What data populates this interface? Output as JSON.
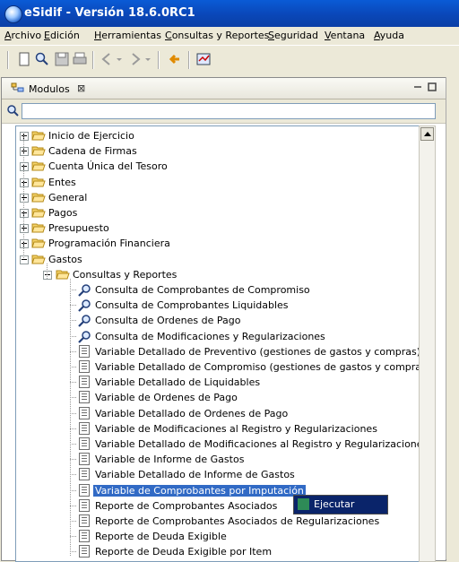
{
  "window": {
    "title": "eSidif - Versión 18.6.0RC1"
  },
  "menu": [
    "Archivo",
    "Edición",
    "Herramientas",
    "Consultas y Reportes",
    "Seguridad",
    "Ventana",
    "Ayuda"
  ],
  "panel": {
    "tab_label": "Modulos",
    "search_value": ""
  },
  "tree": {
    "top_level": [
      "Inicio de Ejercicio",
      "Cadena de Firmas",
      "Cuenta Única del Tesoro",
      "Entes",
      "General",
      "Pagos",
      "Presupuesto",
      "Programación Financiera",
      "Gastos"
    ],
    "subfolder": "Consultas y Reportes",
    "items": [
      {
        "label": "Consulta de Comprobantes de Compromiso",
        "icon": "magnifier-icon"
      },
      {
        "label": "Consulta de Comprobantes Liquidables",
        "icon": "magnifier-icon"
      },
      {
        "label": "Consulta de Ordenes de Pago",
        "icon": "magnifier-icon"
      },
      {
        "label": "Consulta de Modificaciones y Regularizaciones",
        "icon": "magnifier-icon"
      },
      {
        "label": "Variable Detallado de Preventivo (gestiones de gastos y compras)",
        "icon": "document-icon"
      },
      {
        "label": "Variable Detallado de Compromiso (gestiones de gastos y compras)",
        "icon": "document-icon"
      },
      {
        "label": "Variable Detallado de Liquidables",
        "icon": "document-icon"
      },
      {
        "label": "Variable de Ordenes de Pago",
        "icon": "document-icon"
      },
      {
        "label": "Variable Detallado de Ordenes de Pago",
        "icon": "document-icon"
      },
      {
        "label": "Variable de Modificaciones al Registro y Regularizaciones",
        "icon": "document-icon"
      },
      {
        "label": "Variable Detallado de Modificaciones al Registro y Regularizaciones",
        "icon": "document-icon"
      },
      {
        "label": "Variable de Informe de Gastos",
        "icon": "document-icon"
      },
      {
        "label": "Variable Detallado de Informe de Gastos",
        "icon": "document-icon"
      },
      {
        "label": "Variable de Comprobantes por Imputación",
        "icon": "document-icon",
        "selected": true
      },
      {
        "label": "Reporte de Comprobantes Asociados",
        "icon": "document-icon"
      },
      {
        "label": "Reporte de Comprobantes Asociados de Regularizaciones",
        "icon": "document-icon"
      },
      {
        "label": "Reporte de Deuda Exigible",
        "icon": "document-icon"
      },
      {
        "label": "Reporte de Deuda Exigible por Item",
        "icon": "document-icon"
      }
    ]
  },
  "context_menu": {
    "execute_label": "Ejecutar"
  },
  "colors": {
    "selection": "#316ac5",
    "titlebar": "#0a47b8",
    "menu_highlight": "#0a246a"
  }
}
